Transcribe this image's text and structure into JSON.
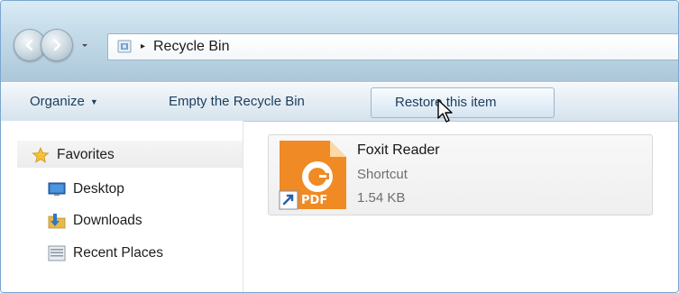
{
  "address": {
    "path_separator": "▸",
    "location": "Recycle Bin"
  },
  "toolbar": {
    "organize_label": "Organize",
    "empty_label": "Empty the Recycle Bin",
    "restore_label": "Restore this item"
  },
  "navigation": {
    "favorites_label": "Favorites",
    "items": [
      {
        "label": "Desktop",
        "icon": "desktop-icon"
      },
      {
        "label": "Downloads",
        "icon": "downloads-folder-icon"
      },
      {
        "label": "Recent Places",
        "icon": "recent-places-icon"
      }
    ]
  },
  "files": [
    {
      "name": "Foxit Reader",
      "type": "Shortcut",
      "size": "1.54 KB",
      "icon": "foxit-reader-pdf-icon",
      "badge": "PDF"
    }
  ],
  "colors": {
    "accent_blue": "#1d3d5c",
    "foxit_orange": "#f08a24"
  }
}
